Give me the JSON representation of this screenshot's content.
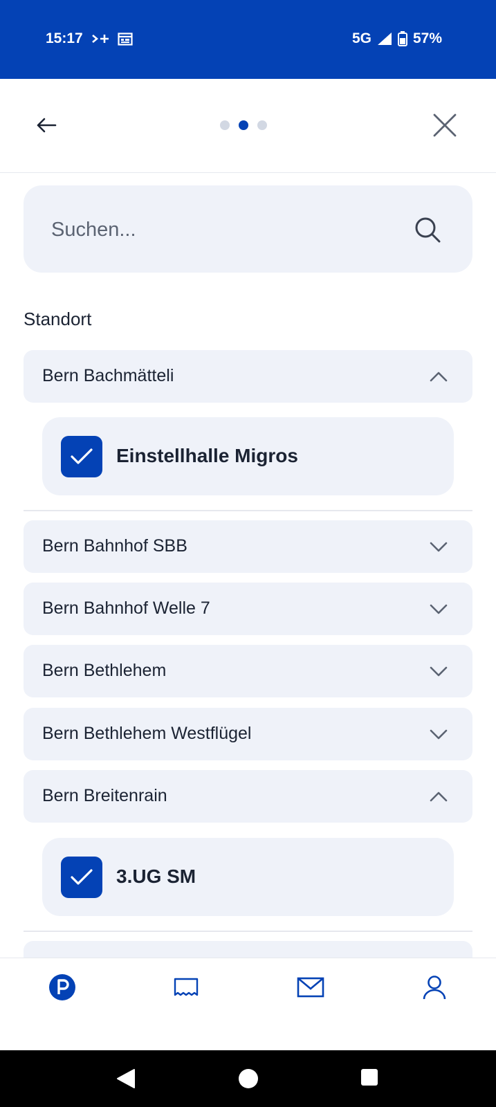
{
  "status_bar": {
    "time": "15:17",
    "extra_icons": [
      "sim-forward-icon",
      "calendar-icon"
    ],
    "network": "5G",
    "battery": "57%",
    "background_color": "#0442b5"
  },
  "nav": {
    "back_icon": "arrow-left-icon",
    "close_icon": "close-icon",
    "pager": {
      "total": 3,
      "active_index": 1
    }
  },
  "search": {
    "placeholder": "Suchen...",
    "value": "",
    "icon": "search-icon"
  },
  "section_label": "Standort",
  "locations": [
    {
      "label": "Bern Bachmätteli",
      "expanded": true,
      "children": [
        {
          "label": "Einstellhalle Migros",
          "checked": true
        }
      ]
    },
    {
      "label": "Bern Bahnhof SBB",
      "expanded": false
    },
    {
      "label": "Bern Bahnhof Welle 7",
      "expanded": false
    },
    {
      "label": "Bern Bethlehem",
      "expanded": false
    },
    {
      "label": "Bern Bethlehem Westflügel",
      "expanded": false
    },
    {
      "label": "Bern Breitenrain",
      "expanded": true,
      "children": [
        {
          "label": "3.UG SM",
          "checked": true
        }
      ]
    }
  ],
  "tab_bar": {
    "tabs": [
      {
        "icon": "parking-icon",
        "active": true
      },
      {
        "icon": "receipt-icon",
        "active": false
      },
      {
        "icon": "mail-icon",
        "active": false
      },
      {
        "icon": "user-icon",
        "active": false
      }
    ]
  },
  "colors": {
    "accent": "#0442b5",
    "card_background": "#eff2f9",
    "text": "#1b2333",
    "muted": "#5b6372"
  }
}
